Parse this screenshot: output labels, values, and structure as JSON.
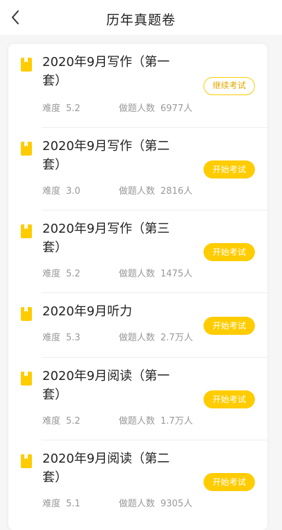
{
  "header": {
    "title": "历年真题卷"
  },
  "colors": {
    "accent": "#ffcc00",
    "text": "#222222",
    "muted": "#999999"
  },
  "labels": {
    "difficulty": "难度",
    "participants": "做题人数"
  },
  "exams": [
    {
      "title": "2020年9月写作（第一套）",
      "difficulty": "5.2",
      "participants": "6977人",
      "action": "继续考试",
      "style": "outline"
    },
    {
      "title": "2020年9月写作（第二套）",
      "difficulty": "3.0",
      "participants": "2816人",
      "action": "开始考试",
      "style": "fill"
    },
    {
      "title": "2020年9月写作（第三套）",
      "difficulty": "5.2",
      "participants": "1475人",
      "action": "开始考试",
      "style": "fill"
    },
    {
      "title": "2020年9月听力",
      "difficulty": "5.3",
      "participants": "2.7万人",
      "action": "开始考试",
      "style": "fill"
    },
    {
      "title": "2020年9月阅读（第一套）",
      "difficulty": "5.2",
      "participants": "1.7万人",
      "action": "开始考试",
      "style": "fill"
    },
    {
      "title": "2020年9月阅读（第二套）",
      "difficulty": "5.1",
      "participants": "9305人",
      "action": "开始考试",
      "style": "fill"
    }
  ]
}
